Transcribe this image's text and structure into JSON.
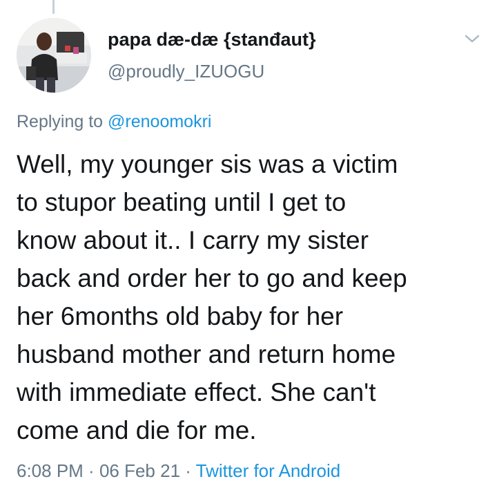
{
  "author": {
    "name": "papa dæ-dæ {stanđaut}",
    "handle": "@proudly_IZUOGU"
  },
  "menu_icon": "chevron-down-icon",
  "reply": {
    "prefix": "Replying to ",
    "mention": "@renoomokri"
  },
  "tweet_lines": [
    "Well, my younger sis was a victim",
    "to stupor beating until I get to",
    "know about it.. I carry my sister",
    "back and order her to go and keep",
    "her 6months old baby for her",
    "husband mother and return home",
    "with immediate effect. She can't",
    "come and die for me."
  ],
  "meta": {
    "time": "6:08 PM",
    "separator": " · ",
    "date": "06 Feb 21",
    "source": "Twitter for Android"
  },
  "colors": {
    "text": "#14171a",
    "secondary": "#657786",
    "link": "#1b95e0"
  }
}
